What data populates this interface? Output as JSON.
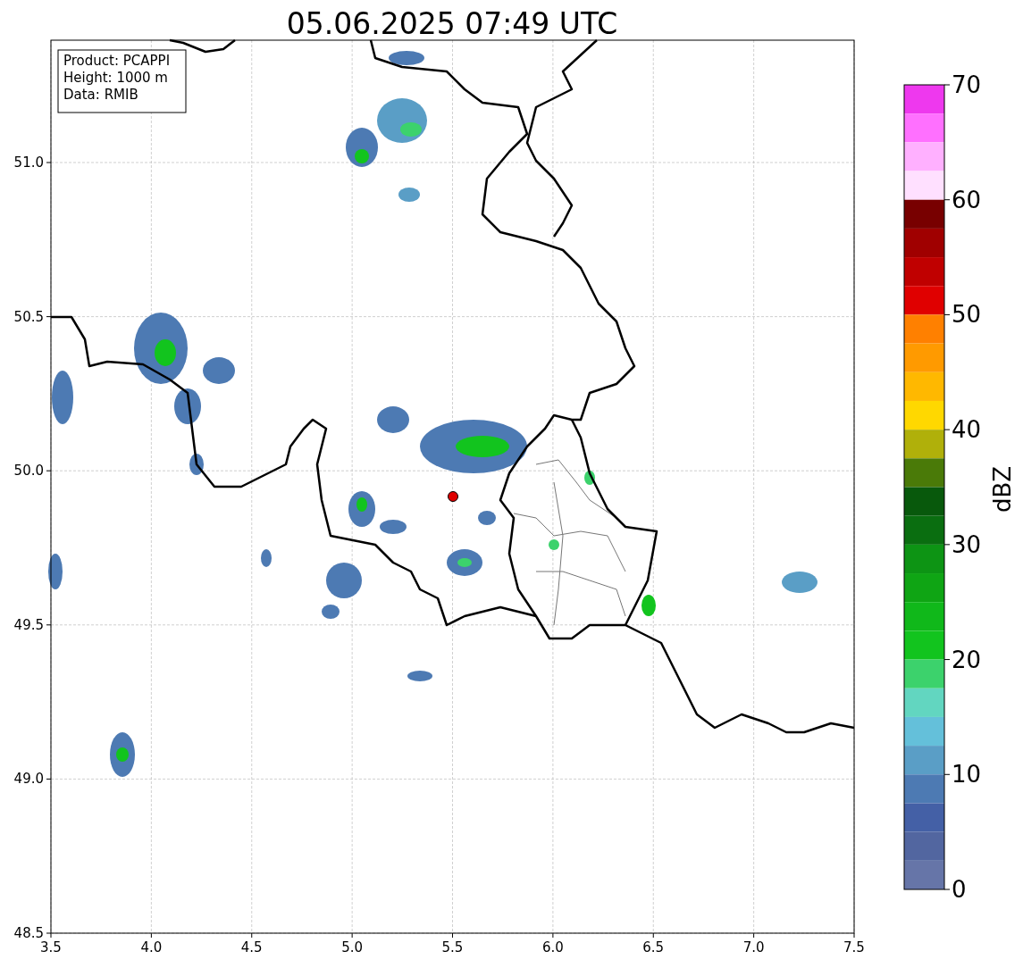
{
  "title": "05.06.2025 07:49 UTC",
  "info_box": [
    "Product: PCAPPI",
    "Height: 1000 m",
    "Data: RMIB"
  ],
  "map": {
    "xticks": [
      "3.5",
      "4.0",
      "4.5",
      "5.0",
      "5.5",
      "6.0",
      "6.5",
      "7.0",
      "7.5"
    ],
    "yticks": [
      "51.0",
      "50.5",
      "50.0",
      "49.5",
      "49.0",
      "48.5"
    ]
  },
  "colorbar": {
    "label": "dBZ",
    "ticks": [
      "70",
      "60",
      "50",
      "40",
      "30",
      "20",
      "10",
      "0"
    ],
    "segments": [
      {
        "color": "#ee38ee"
      },
      {
        "color": "#ff70ff"
      },
      {
        "color": "#ffb0ff"
      },
      {
        "color": "#ffe0ff"
      },
      {
        "color": "#780000"
      },
      {
        "color": "#a00000"
      },
      {
        "color": "#c00000"
      },
      {
        "color": "#e00000"
      },
      {
        "color": "#ff8000"
      },
      {
        "color": "#ff9a00"
      },
      {
        "color": "#ffb800"
      },
      {
        "color": "#ffd800"
      },
      {
        "color": "#b0b00a"
      },
      {
        "color": "#4a7a08"
      },
      {
        "color": "#08590c"
      },
      {
        "color": "#0a6e10"
      },
      {
        "color": "#0d9414"
      },
      {
        "color": "#0fa514"
      },
      {
        "color": "#10b81a"
      },
      {
        "color": "#12c41e"
      },
      {
        "color": "#3cd26c"
      },
      {
        "color": "#62d6c0"
      },
      {
        "color": "#64c0da"
      },
      {
        "color": "#5a9ec6"
      },
      {
        "color": "#4d7ab3"
      },
      {
        "color": "#4460a6"
      },
      {
        "color": "#5266a0"
      },
      {
        "color": "#6675a8"
      }
    ]
  }
}
